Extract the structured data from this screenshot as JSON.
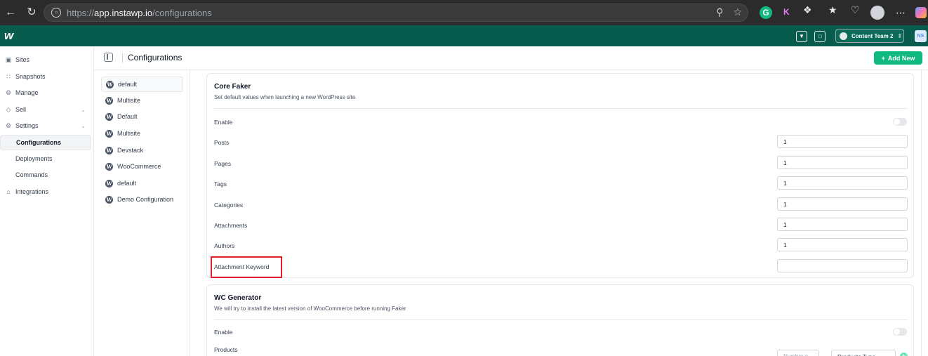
{
  "browser": {
    "url_prefix": "https://",
    "url_host": "app.instawp.io",
    "url_path": "/configurations",
    "ext_g": "G",
    "ext_k": "K"
  },
  "app": {
    "logo": "w",
    "team_name": "Content Team 2",
    "user_initials": "NS"
  },
  "sidebar": {
    "items": [
      {
        "label": "Sites",
        "icon": "sites-icon"
      },
      {
        "label": "Snapshots",
        "icon": "snapshots-icon"
      },
      {
        "label": "Manage",
        "icon": "manage-icon"
      },
      {
        "label": "Sell",
        "icon": "sell-icon"
      },
      {
        "label": "Settings",
        "icon": "settings-icon"
      }
    ],
    "settings_children": [
      "Configurations",
      "Deployments",
      "Commands"
    ],
    "integrations": "Integrations"
  },
  "page": {
    "title": "Configurations",
    "add_button": "Add New"
  },
  "configs": [
    "default",
    "Multisite",
    "Default",
    "Multisite",
    "Devstack",
    "WooCommerce",
    "default",
    "Demo Configuration"
  ],
  "core_faker": {
    "title": "Core Faker",
    "subtitle": "Set default values when launching a new WordPress site",
    "enable_label": "Enable",
    "enabled": false,
    "fields": [
      {
        "label": "Posts",
        "value": "1"
      },
      {
        "label": "Pages",
        "value": "1"
      },
      {
        "label": "Tags",
        "value": "1"
      },
      {
        "label": "Categories",
        "value": "1"
      },
      {
        "label": "Attachments",
        "value": "1"
      },
      {
        "label": "Authors",
        "value": "1"
      },
      {
        "label": "Attachment Keyword",
        "value": ""
      }
    ]
  },
  "wc_generator": {
    "title": "WC Generator",
    "subtitle": "We will try to install the latest version of WooCommerce before running Faker",
    "enable_label": "Enable",
    "enabled": false,
    "products_label": "Products",
    "number_placeholder": "Number o...",
    "products_type": "Products Type"
  },
  "colors": {
    "brand": "#075c4d",
    "accent": "#10b981",
    "highlight": "#e11d2e"
  }
}
